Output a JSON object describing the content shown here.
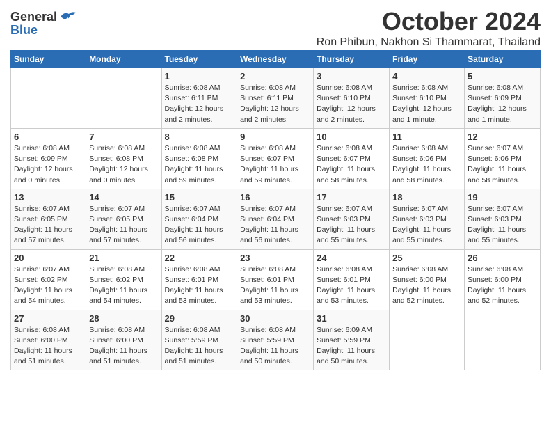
{
  "logo": {
    "general": "General",
    "blue": "Blue"
  },
  "title": {
    "month": "October 2024",
    "location": "Ron Phibun, Nakhon Si Thammarat, Thailand"
  },
  "weekdays": [
    "Sunday",
    "Monday",
    "Tuesday",
    "Wednesday",
    "Thursday",
    "Friday",
    "Saturday"
  ],
  "weeks": [
    [
      {
        "day": "",
        "info": ""
      },
      {
        "day": "",
        "info": ""
      },
      {
        "day": "1",
        "info": "Sunrise: 6:08 AM\nSunset: 6:11 PM\nDaylight: 12 hours and 2 minutes."
      },
      {
        "day": "2",
        "info": "Sunrise: 6:08 AM\nSunset: 6:11 PM\nDaylight: 12 hours and 2 minutes."
      },
      {
        "day": "3",
        "info": "Sunrise: 6:08 AM\nSunset: 6:10 PM\nDaylight: 12 hours and 2 minutes."
      },
      {
        "day": "4",
        "info": "Sunrise: 6:08 AM\nSunset: 6:10 PM\nDaylight: 12 hours and 1 minute."
      },
      {
        "day": "5",
        "info": "Sunrise: 6:08 AM\nSunset: 6:09 PM\nDaylight: 12 hours and 1 minute."
      }
    ],
    [
      {
        "day": "6",
        "info": "Sunrise: 6:08 AM\nSunset: 6:09 PM\nDaylight: 12 hours and 0 minutes."
      },
      {
        "day": "7",
        "info": "Sunrise: 6:08 AM\nSunset: 6:08 PM\nDaylight: 12 hours and 0 minutes."
      },
      {
        "day": "8",
        "info": "Sunrise: 6:08 AM\nSunset: 6:08 PM\nDaylight: 11 hours and 59 minutes."
      },
      {
        "day": "9",
        "info": "Sunrise: 6:08 AM\nSunset: 6:07 PM\nDaylight: 11 hours and 59 minutes."
      },
      {
        "day": "10",
        "info": "Sunrise: 6:08 AM\nSunset: 6:07 PM\nDaylight: 11 hours and 58 minutes."
      },
      {
        "day": "11",
        "info": "Sunrise: 6:08 AM\nSunset: 6:06 PM\nDaylight: 11 hours and 58 minutes."
      },
      {
        "day": "12",
        "info": "Sunrise: 6:07 AM\nSunset: 6:06 PM\nDaylight: 11 hours and 58 minutes."
      }
    ],
    [
      {
        "day": "13",
        "info": "Sunrise: 6:07 AM\nSunset: 6:05 PM\nDaylight: 11 hours and 57 minutes."
      },
      {
        "day": "14",
        "info": "Sunrise: 6:07 AM\nSunset: 6:05 PM\nDaylight: 11 hours and 57 minutes."
      },
      {
        "day": "15",
        "info": "Sunrise: 6:07 AM\nSunset: 6:04 PM\nDaylight: 11 hours and 56 minutes."
      },
      {
        "day": "16",
        "info": "Sunrise: 6:07 AM\nSunset: 6:04 PM\nDaylight: 11 hours and 56 minutes."
      },
      {
        "day": "17",
        "info": "Sunrise: 6:07 AM\nSunset: 6:03 PM\nDaylight: 11 hours and 55 minutes."
      },
      {
        "day": "18",
        "info": "Sunrise: 6:07 AM\nSunset: 6:03 PM\nDaylight: 11 hours and 55 minutes."
      },
      {
        "day": "19",
        "info": "Sunrise: 6:07 AM\nSunset: 6:03 PM\nDaylight: 11 hours and 55 minutes."
      }
    ],
    [
      {
        "day": "20",
        "info": "Sunrise: 6:07 AM\nSunset: 6:02 PM\nDaylight: 11 hours and 54 minutes."
      },
      {
        "day": "21",
        "info": "Sunrise: 6:08 AM\nSunset: 6:02 PM\nDaylight: 11 hours and 54 minutes."
      },
      {
        "day": "22",
        "info": "Sunrise: 6:08 AM\nSunset: 6:01 PM\nDaylight: 11 hours and 53 minutes."
      },
      {
        "day": "23",
        "info": "Sunrise: 6:08 AM\nSunset: 6:01 PM\nDaylight: 11 hours and 53 minutes."
      },
      {
        "day": "24",
        "info": "Sunrise: 6:08 AM\nSunset: 6:01 PM\nDaylight: 11 hours and 53 minutes."
      },
      {
        "day": "25",
        "info": "Sunrise: 6:08 AM\nSunset: 6:00 PM\nDaylight: 11 hours and 52 minutes."
      },
      {
        "day": "26",
        "info": "Sunrise: 6:08 AM\nSunset: 6:00 PM\nDaylight: 11 hours and 52 minutes."
      }
    ],
    [
      {
        "day": "27",
        "info": "Sunrise: 6:08 AM\nSunset: 6:00 PM\nDaylight: 11 hours and 51 minutes."
      },
      {
        "day": "28",
        "info": "Sunrise: 6:08 AM\nSunset: 6:00 PM\nDaylight: 11 hours and 51 minutes."
      },
      {
        "day": "29",
        "info": "Sunrise: 6:08 AM\nSunset: 5:59 PM\nDaylight: 11 hours and 51 minutes."
      },
      {
        "day": "30",
        "info": "Sunrise: 6:08 AM\nSunset: 5:59 PM\nDaylight: 11 hours and 50 minutes."
      },
      {
        "day": "31",
        "info": "Sunrise: 6:09 AM\nSunset: 5:59 PM\nDaylight: 11 hours and 50 minutes."
      },
      {
        "day": "",
        "info": ""
      },
      {
        "day": "",
        "info": ""
      }
    ]
  ]
}
